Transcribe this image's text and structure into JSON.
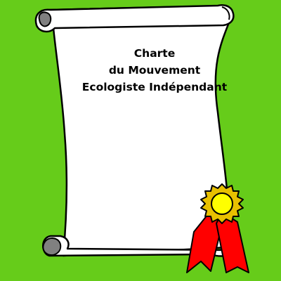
{
  "charter": {
    "title_lines": [
      "Charte",
      "du Mouvement",
      "Ecologiste Indépendant"
    ]
  },
  "colors": {
    "background": "#66cc1a",
    "paper": "#ffffff",
    "outline": "#000000",
    "scroll_curl": "#808080",
    "ribbon": "#ff0000",
    "seal_gold": "#ffd700",
    "seal_center": "#ffff00"
  },
  "icons": {
    "scroll": "scroll-icon",
    "seal": "award-ribbon-seal-icon"
  }
}
